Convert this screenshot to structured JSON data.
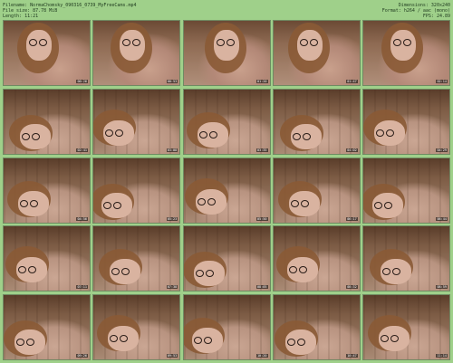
{
  "header": {
    "filename": "Filename: NormaChomsky_090316_0739_MyFreeCams.mp4",
    "filesize": "File size: 87.78 MiB",
    "length": "Length: 11:21",
    "dimensions": "Dimensions: 320x240",
    "format": "Format: h264 / aac (mono)",
    "fps": "FPS: 24.89"
  },
  "thumbnails": [
    {
      "time": "00:26"
    },
    {
      "time": "00:53"
    },
    {
      "time": "01:20"
    },
    {
      "time": "01:47"
    },
    {
      "time": "02:14"
    },
    {
      "time": "02:41"
    },
    {
      "time": "03:08"
    },
    {
      "time": "03:35"
    },
    {
      "time": "04:02"
    },
    {
      "time": "04:29"
    },
    {
      "time": "04:56"
    },
    {
      "time": "05:23"
    },
    {
      "time": "05:50"
    },
    {
      "time": "06:17"
    },
    {
      "time": "06:44"
    },
    {
      "time": "07:11"
    },
    {
      "time": "07:38"
    },
    {
      "time": "08:05"
    },
    {
      "time": "08:32"
    },
    {
      "time": "08:59"
    },
    {
      "time": "09:26"
    },
    {
      "time": "09:53"
    },
    {
      "time": "10:20"
    },
    {
      "time": "10:47"
    },
    {
      "time": "11:14"
    }
  ]
}
